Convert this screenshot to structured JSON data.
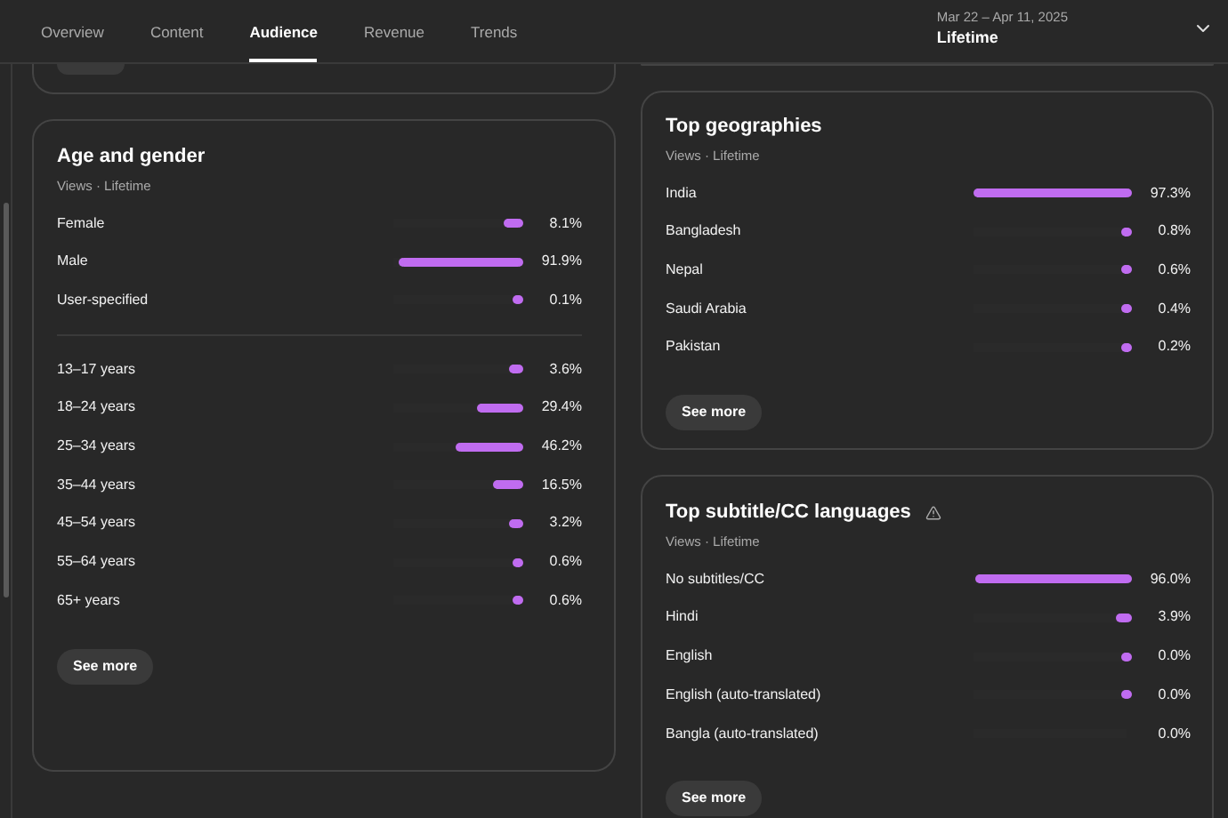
{
  "tabs": [
    {
      "label": "Overview",
      "selected": false
    },
    {
      "label": "Content",
      "selected": false
    },
    {
      "label": "Audience",
      "selected": true
    },
    {
      "label": "Revenue",
      "selected": false
    },
    {
      "label": "Trends",
      "selected": false
    }
  ],
  "date_range": {
    "range": "Mar 22 – Apr 11, 2025",
    "period": "Lifetime"
  },
  "age_and_gender": {
    "title": "Age and gender",
    "subtitle": "Views · Lifetime",
    "gender": [
      {
        "label": "Female",
        "level": 0.081,
        "value": "8.1%"
      },
      {
        "label": "Male",
        "level": 0.919,
        "value": "91.9%"
      },
      {
        "label": "User-specified",
        "level": 0.001,
        "value": "0.1%"
      }
    ],
    "age": [
      {
        "label": "13–17 years",
        "level": 0.036,
        "value": "3.6%"
      },
      {
        "label": "18–24 years",
        "level": 0.294,
        "value": "29.4%"
      },
      {
        "label": "25–34 years",
        "level": 0.462,
        "value": "46.2%"
      },
      {
        "label": "35–44 years",
        "level": 0.165,
        "value": "16.5%"
      },
      {
        "label": "45–54 years",
        "level": 0.032,
        "value": "3.2%"
      },
      {
        "label": "55–64 years",
        "level": 0.006,
        "value": "0.6%"
      },
      {
        "label": "65+ years",
        "level": 0.006,
        "value": "0.6%"
      }
    ],
    "button": "See more"
  },
  "top_geographies": {
    "title": "Top geographies",
    "subtitle": "Views · Lifetime",
    "rows": [
      {
        "label": "India",
        "level": 0.973,
        "value": "97.3%"
      },
      {
        "label": "Bangladesh",
        "level": 0.008,
        "value": "0.8%"
      },
      {
        "label": "Nepal",
        "level": 0.006,
        "value": "0.6%"
      },
      {
        "label": "Saudi Arabia",
        "level": 0.004,
        "value": "0.4%"
      },
      {
        "label": "Pakistan",
        "level": 0.002,
        "value": "0.2%"
      }
    ],
    "button": "See more"
  },
  "top_subtitle_languages": {
    "title": "Top subtitle/CC languages",
    "warning": true,
    "subtitle": "Views · Lifetime",
    "rows": [
      {
        "label": "No subtitles/CC",
        "level": 0.96,
        "value": "96.0%"
      },
      {
        "label": "Hindi",
        "level": 0.039,
        "value": "3.9%"
      },
      {
        "label": "English",
        "level": 0.0004,
        "value": "0.0%"
      },
      {
        "label": "English (auto-translated)",
        "level": 0.0003,
        "value": "0.0%"
      },
      {
        "label": "Bangla (auto-translated)",
        "value": "0.0%"
      }
    ],
    "button": "See more"
  }
}
